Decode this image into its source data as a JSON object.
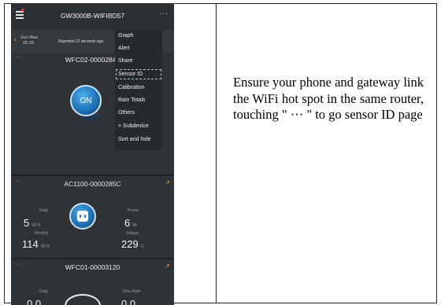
{
  "header": {
    "title": "GW3000B-WIFIBD57",
    "menu_icon": "hamburger-icon",
    "more_icon": "ellipsis-icon",
    "more_label": "···"
  },
  "status": {
    "sunrise_label": "Sun Rise",
    "sunrise_time": "05:39",
    "reported": "Reported 22 seconds ago"
  },
  "menu": {
    "items": [
      "Graph",
      "Alert",
      "Share",
      "Sensor ID",
      "Calibration",
      "Rain Totals",
      "Others",
      "+ Subdevice",
      "Sort and hide"
    ],
    "highlighted": "Sensor ID"
  },
  "devices": [
    {
      "title": "WFC02-00002847",
      "button_label": "ON",
      "dots": "···"
    },
    {
      "title": "AC1100-0000285C",
      "dots": "···",
      "daily_label": "Daily",
      "daily_value": "5",
      "daily_unit": "W·h",
      "power_label": "Power",
      "power_value": "6",
      "power_unit": "W",
      "monthly_label": "Monthly",
      "monthly_value": "114",
      "monthly_unit": "W·h",
      "voltage_label": "Voltage",
      "voltage_value": "229",
      "voltage_unit": "V"
    },
    {
      "title": "WFC01-00003120",
      "dots": "···",
      "daily_label": "Daily",
      "flow_label": "Flow Rate",
      "daily_value": "0.0",
      "flow_value": "0.0"
    }
  ],
  "instruction": "Ensure your phone and gateway link the WiFi hot spot in the same router, touching \" ··· \" to go sensor ID page",
  "colors": {
    "phone_bg": "#2f3337",
    "accent_orange": "#f0a640",
    "accent_blue": "#1f74b8",
    "notification": "#e53935"
  }
}
